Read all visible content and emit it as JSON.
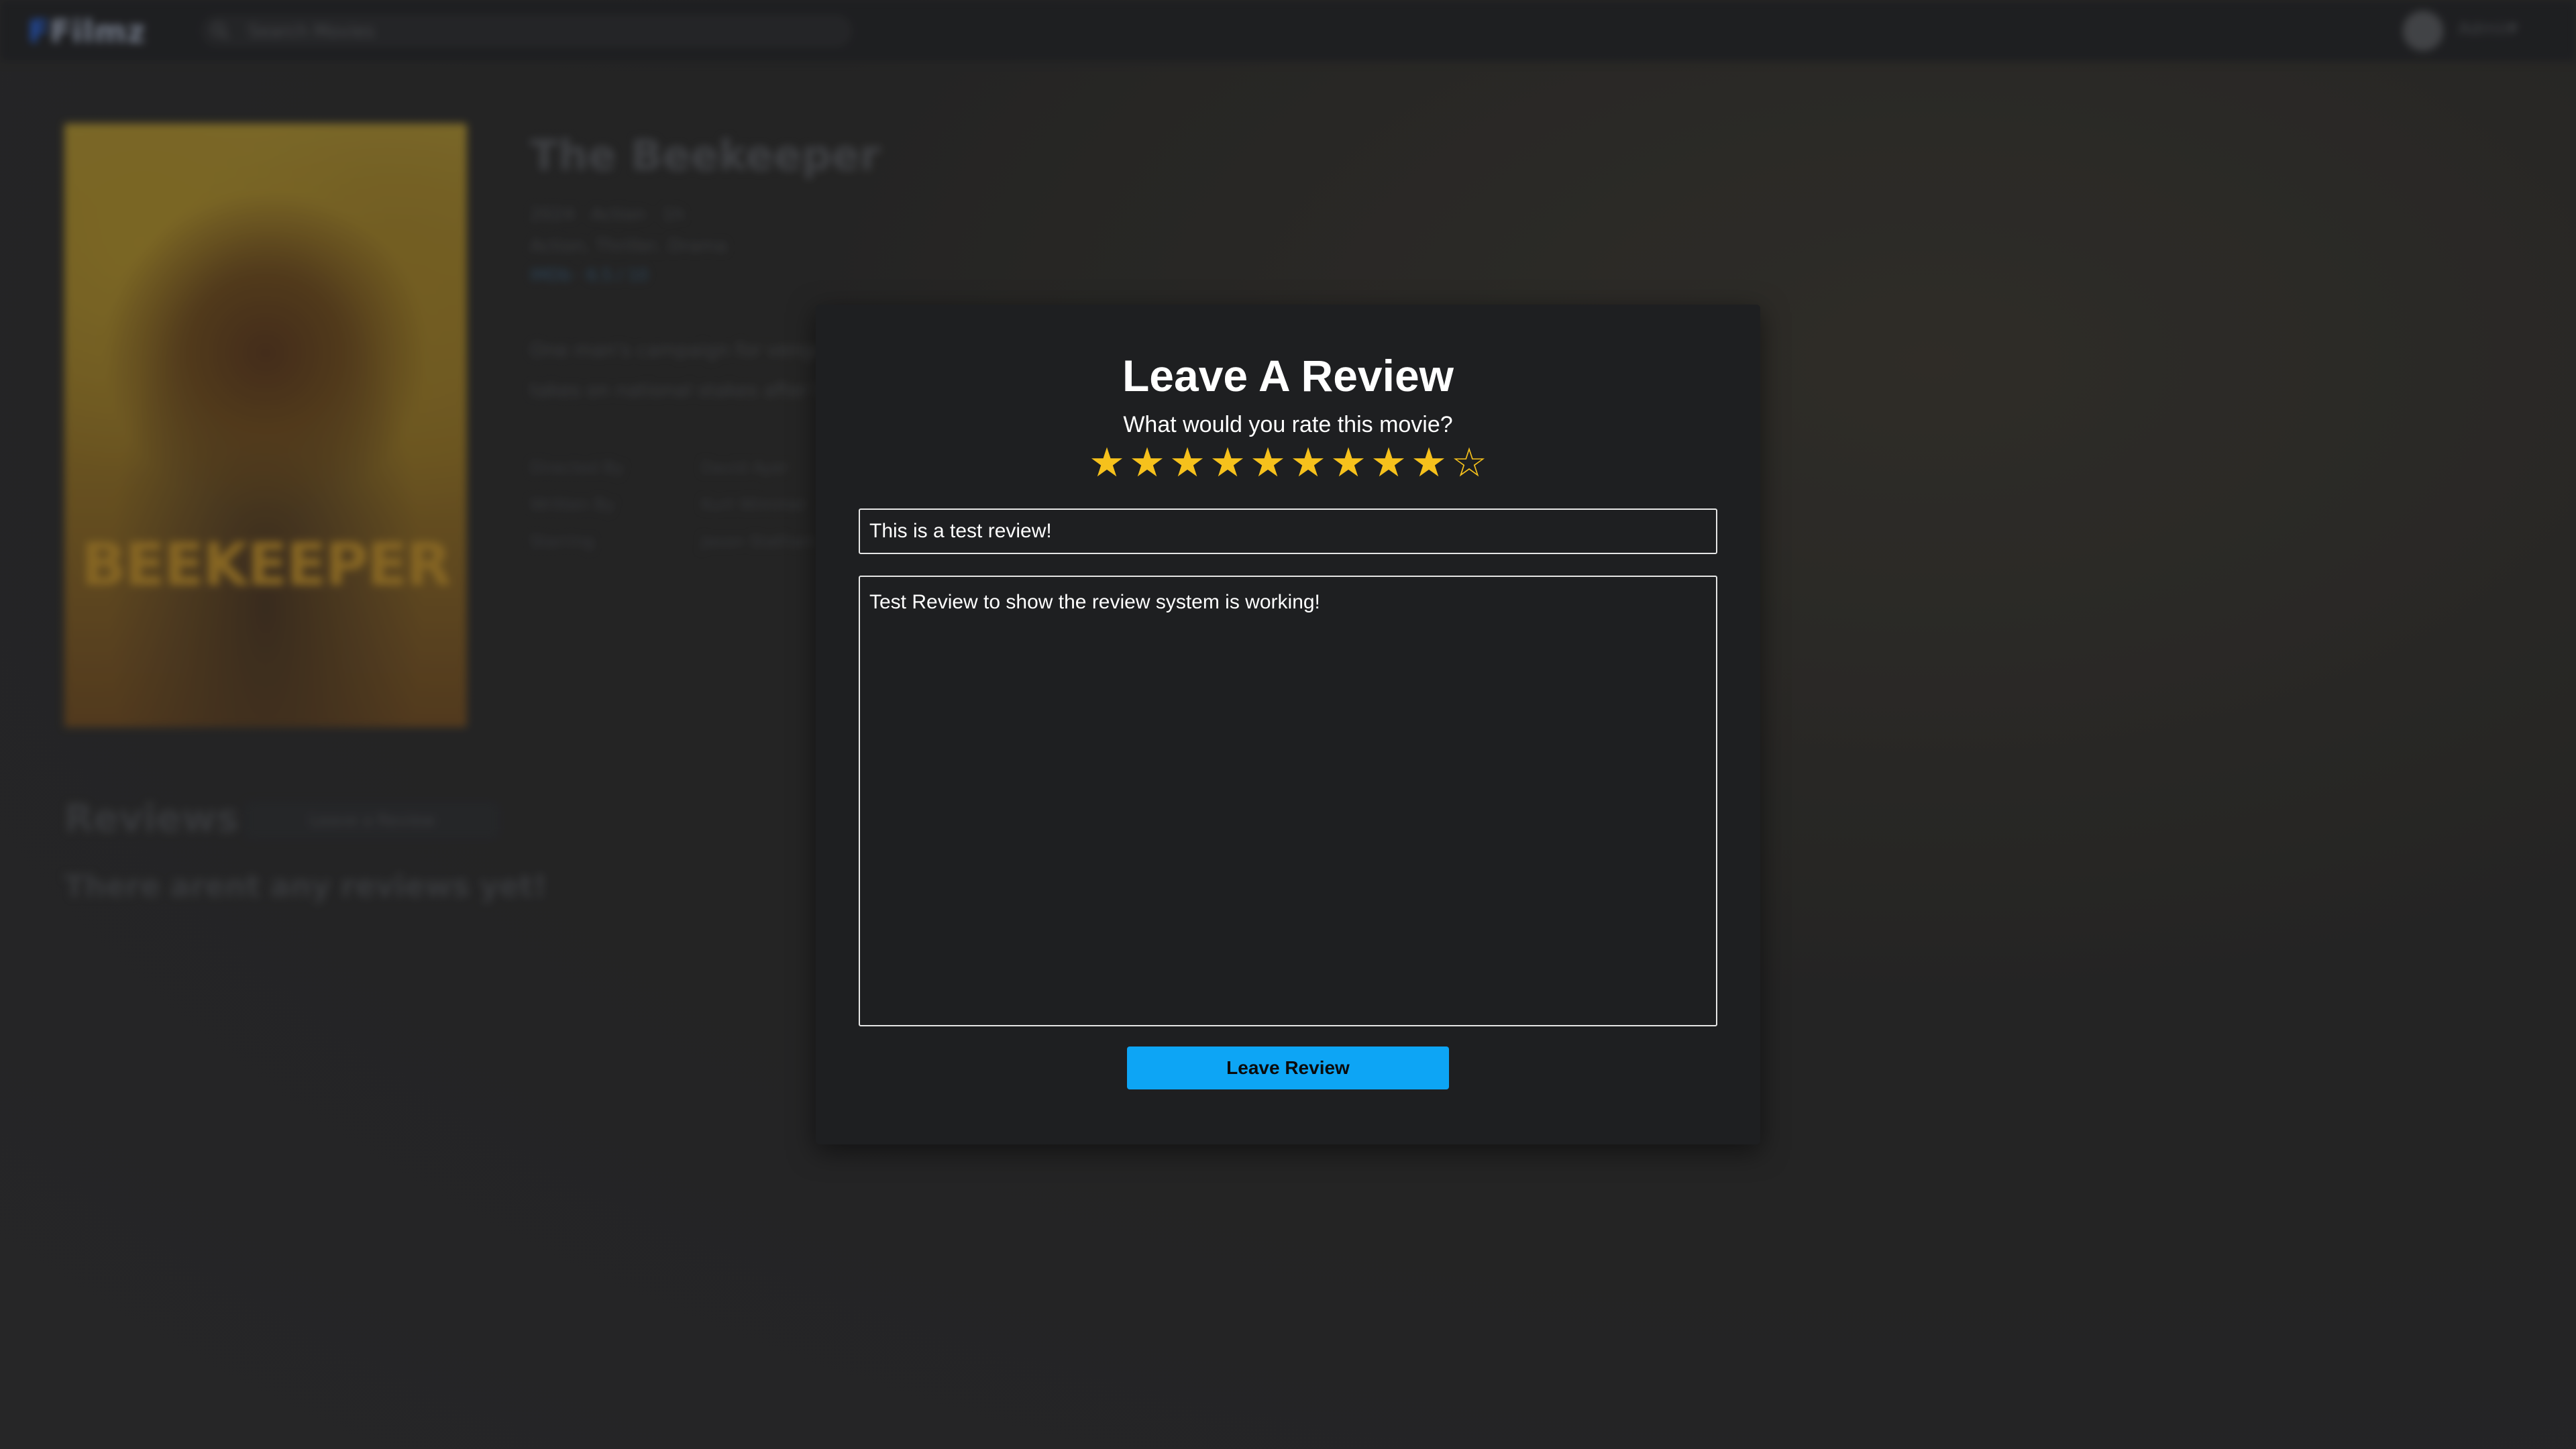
{
  "app": {
    "logo_text_prefix": "F",
    "logo_text": "Filmz"
  },
  "search": {
    "placeholder": "Search Movies"
  },
  "user": {
    "name": "Admin",
    "chevron": "▾"
  },
  "movie": {
    "title": "The Beekeeper",
    "meta_line1": "2024 · Action · 1h",
    "meta_line2": "Action, Thriller, Drama",
    "meta_line3": "IMDb · 6.5 / 10",
    "description_line1": "One man's campaign for vengeance",
    "description_line2": "takes on national stakes after he",
    "poster_text": "BEEKEEPER",
    "crew": [
      {
        "key": "Directed By",
        "value": "David Ayer"
      },
      {
        "key": "Written By",
        "value": "Kurt Wimmer"
      },
      {
        "key": "Starring",
        "value": "Jason Statham"
      }
    ]
  },
  "reviews": {
    "heading": "Reviews",
    "button_label": "Leave a Review",
    "empty_text": "There arent any reviews yet!"
  },
  "modal": {
    "title": "Leave A Review",
    "subtitle": "What would you rate this movie?",
    "rating": 9,
    "rating_max": 10,
    "star_filled_glyph": "★",
    "star_empty_glyph": "☆",
    "star_color": "#f6c11c",
    "review_title_value": "This is a test review!",
    "review_body_value": "Test Review to show the review system is working!",
    "submit_label": "Leave Review",
    "submit_color": "#0da5f5"
  }
}
